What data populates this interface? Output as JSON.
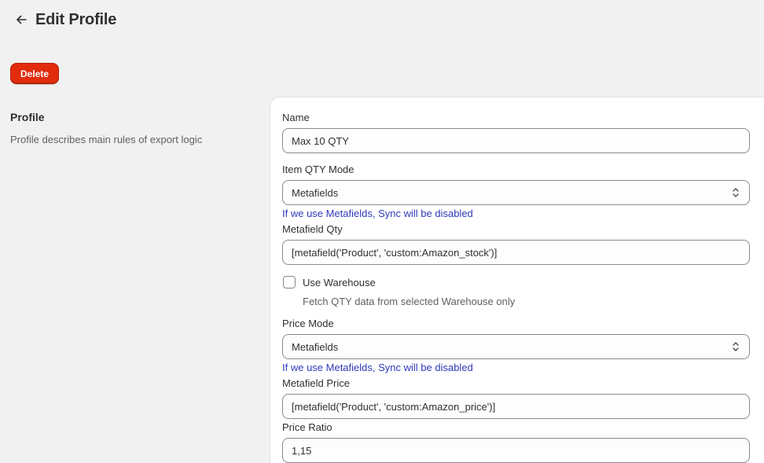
{
  "header": {
    "back_icon": "arrow-left-icon",
    "title": "Edit Profile"
  },
  "actions": {
    "delete_label": "Delete",
    "delete_color": "#e22c0e"
  },
  "section": {
    "title": "Profile",
    "description": "Profile describes main rules of export logic"
  },
  "form": {
    "name": {
      "label": "Name",
      "value": "Max 10 QTY"
    },
    "item_qty_mode": {
      "label": "Item QTY Mode",
      "selected": "Metafields",
      "help": "If we use Metafields, Sync will be disabled",
      "icon": "chevron-up-down-icon"
    },
    "metafield_qty": {
      "label": "Metafield Qty",
      "value": "[metafield('Product', 'custom:Amazon_stock')]"
    },
    "use_warehouse": {
      "label": "Use Warehouse",
      "checked": false,
      "help": "Fetch QTY data from selected Warehouse only"
    },
    "price_mode": {
      "label": "Price Mode",
      "selected": "Metafields",
      "help": "If we use Metafields, Sync will be disabled",
      "icon": "chevron-up-down-icon"
    },
    "metafield_price": {
      "label": "Metafield Price",
      "value": "[metafield('Product', 'custom:Amazon_price')]"
    },
    "price_ratio": {
      "label": "Price Ratio",
      "value": "1,15"
    }
  },
  "colors": {
    "help_link": "#2d3bb8",
    "background": "#f1f1f1"
  }
}
